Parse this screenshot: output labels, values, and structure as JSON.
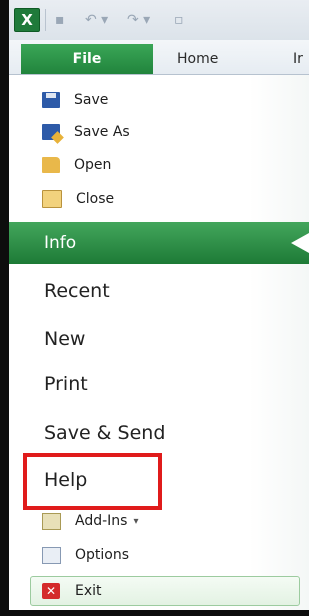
{
  "quick_access": {
    "app_icon": "excel-logo",
    "app_letter": "X",
    "icons": [
      "save-icon",
      "undo-icon",
      "redo-icon",
      "new-document-icon"
    ],
    "glyphs": {
      "save": "▪",
      "undo": "↶ ▾",
      "redo": "↷ ▾",
      "doc": "▫"
    }
  },
  "ribbon": {
    "file_tab": "File",
    "tabs": [
      "Home",
      "Ir"
    ]
  },
  "backstage": {
    "commands": [
      {
        "label": "Save",
        "icon": "save-icon"
      },
      {
        "label": "Save As",
        "icon": "save-as-icon"
      },
      {
        "label": "Open",
        "icon": "open-folder-icon"
      },
      {
        "label": "Close",
        "icon": "close-folder-icon"
      }
    ],
    "selected": "Info",
    "items": [
      "Recent",
      "New",
      "Print",
      "Save & Send",
      "Help"
    ],
    "sub_commands": [
      {
        "label": "Add-Ins",
        "icon": "add-ins-icon",
        "caret": "▾"
      },
      {
        "label": "Options",
        "icon": "options-icon"
      }
    ],
    "exit": {
      "label": "Exit",
      "icon": "exit-icon",
      "glyph": "✕"
    }
  },
  "colors": {
    "accent_green": "#1d7a36",
    "highlight_red": "#e01b1b"
  }
}
